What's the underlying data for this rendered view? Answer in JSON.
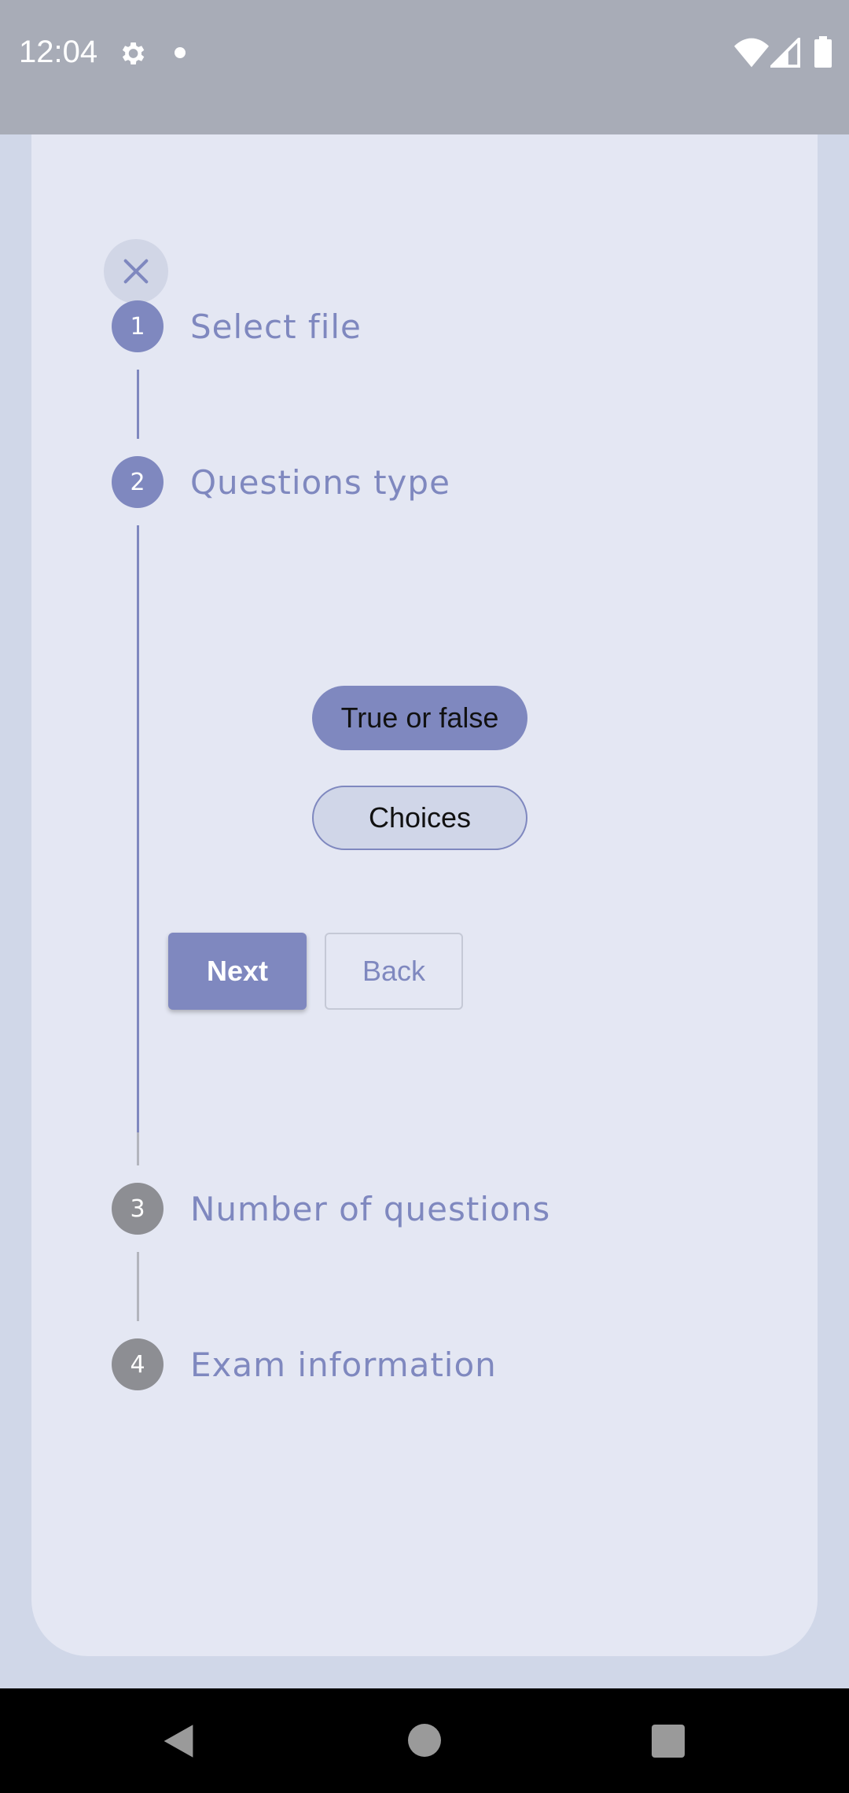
{
  "status_bar": {
    "time": "12:04"
  },
  "stepper": {
    "steps": [
      {
        "number": "1",
        "label": "Select file"
      },
      {
        "number": "2",
        "label": "Questions type"
      },
      {
        "number": "3",
        "label": "Number of questions"
      },
      {
        "number": "4",
        "label": "Exam information"
      }
    ],
    "active_step": 2
  },
  "question_types": {
    "options": [
      "True or false",
      "Choices"
    ],
    "selected": "True or false"
  },
  "actions": {
    "next_label": "Next",
    "back_label": "Back"
  },
  "colors": {
    "accent": "#7f88bf",
    "card_background": "#e4e7f3",
    "page_background": "#d0d7e8",
    "inactive_step": "#8d8e93"
  }
}
